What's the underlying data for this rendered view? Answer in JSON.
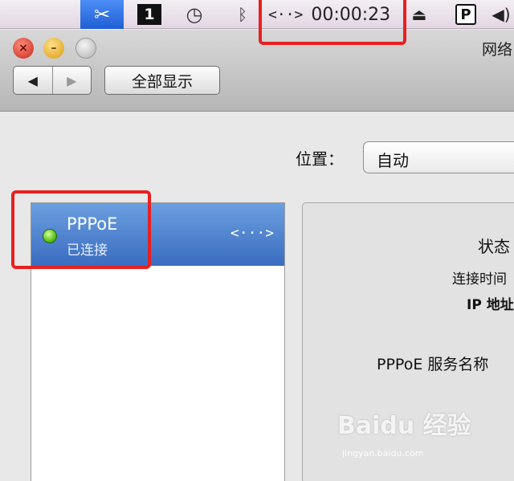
{
  "menubar": {
    "icons": [
      "scissors-icon",
      "space-number-icon",
      "time-machine-icon",
      "bluetooth-icon",
      "ppp-connection-icon",
      "eject-icon",
      "p-icon",
      "volume-icon"
    ],
    "space_number": "1",
    "connection_glyph": "<··>",
    "connection_timer": "00:00:23",
    "p_label": "P"
  },
  "window": {
    "title": "网络"
  },
  "toolbar": {
    "back_label": "◀",
    "forward_label": "▶",
    "show_all_label": "全部显示"
  },
  "location": {
    "label": "位置：",
    "value": "自动"
  },
  "services": [
    {
      "name": "PPPoE",
      "status": "已连接",
      "status_color": "#58c21a"
    }
  ],
  "detail": {
    "status_label": "状态",
    "connect_time_label": "连接时间",
    "ip_label": "IP 地址",
    "service_name_label": "PPPoE 服务名称"
  },
  "watermark": {
    "main": "Baidu 经验",
    "sub": "jingyan.baidu.com"
  },
  "colors": {
    "highlight": "#e82020",
    "selection": "#3a6cc0"
  }
}
